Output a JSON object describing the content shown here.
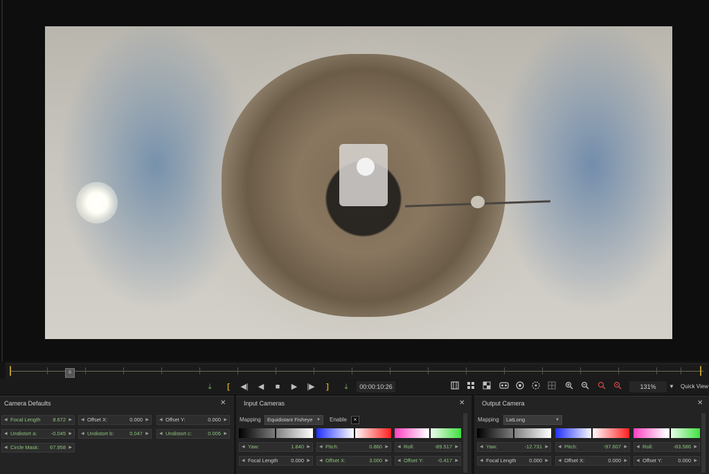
{
  "timeline": {
    "playhead_label": "0"
  },
  "transport": {
    "btn_set_in": "⤓",
    "btn_mark_in": "[",
    "btn_step_back": "◀|",
    "btn_play_back": "◀",
    "btn_stop": "■",
    "btn_play": "▶",
    "btn_step_fwd": "|▶",
    "btn_mark_out": "]",
    "btn_set_out": "⤓",
    "timecode": "00:00:10:26",
    "zoom": "131%",
    "quick_view": "Quick View"
  },
  "panels": {
    "camera_defaults": {
      "title": "Camera Defaults",
      "fields": [
        {
          "label": "Focal Length",
          "value": "8.672"
        },
        {
          "label": "Offset X:",
          "value": "0.000"
        },
        {
          "label": "Offset Y:",
          "value": "0.000"
        },
        {
          "label": "Undistort a:",
          "value": "-0.045"
        },
        {
          "label": "Undistort b:",
          "value": "0.047"
        },
        {
          "label": "Undistort c:",
          "value": "0.006"
        },
        {
          "label": "Circle Mask:",
          "value": "67.958"
        }
      ]
    },
    "input_cameras": {
      "title": "Input Cameras",
      "mapping_label": "Mapping",
      "mapping_value": "Equidistant Fisheye",
      "enable_label": "Enable",
      "enable_mark": "×",
      "fields": [
        {
          "label": "Yaw:",
          "value": "1.840"
        },
        {
          "label": "Pitch:",
          "value": "0.860"
        },
        {
          "label": "Roll:",
          "value": "-89.517"
        },
        {
          "label": "Focal Length",
          "value": "0.000"
        },
        {
          "label": "Offset X:",
          "value": "3.000"
        },
        {
          "label": "Offset Y:",
          "value": "-0.417"
        }
      ]
    },
    "output_camera": {
      "title": "Output Camera",
      "mapping_label": "Mapping",
      "mapping_value": "LatLong",
      "fields": [
        {
          "label": "Yaw:",
          "value": "-12.731"
        },
        {
          "label": "Pitch:",
          "value": "-97.607"
        },
        {
          "label": "Roll:",
          "value": "-83.586"
        },
        {
          "label": "Focal Length",
          "value": "0.000"
        },
        {
          "label": "Offset X:",
          "value": "0.000"
        },
        {
          "label": "Offset Y:",
          "value": "0.000"
        }
      ]
    },
    "close_icon": "✕"
  },
  "colors": {
    "accent_gold": "#d4a52a",
    "label_green": "#8cc27b"
  }
}
